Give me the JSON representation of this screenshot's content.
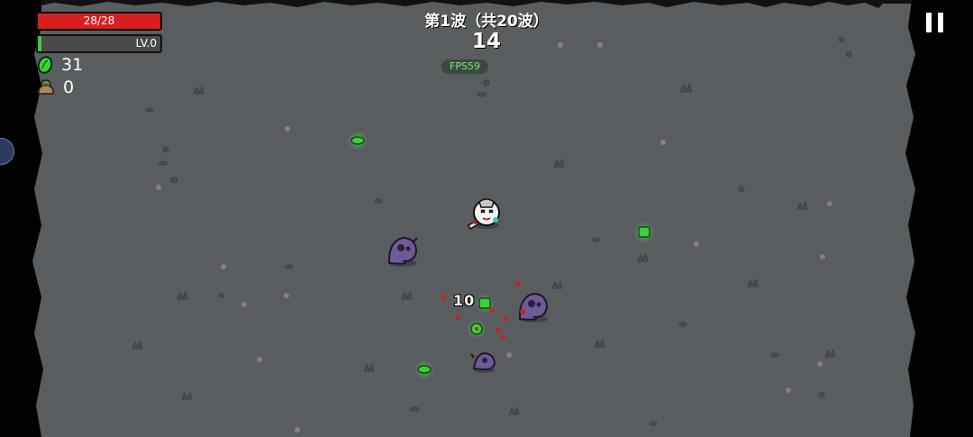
{
  "hud": {
    "hp_text": "28/28",
    "hp_fraction": 1.0,
    "level_text": "LV.0",
    "xp_fraction": 0.03,
    "materials_count": "31",
    "bag_count": "0",
    "wave_title": "第1波（共20波）",
    "timer": "14",
    "fps": "FPS59",
    "damage_number": "10"
  },
  "icons": {
    "materials": "green-material-icon",
    "bag": "loot-bag-icon",
    "pause": "pause-icon"
  },
  "colors": {
    "arena_floor": "#595d60",
    "hp_red": "#d81e1e",
    "xp_green": "#45c63b",
    "material_green": "#3bd13b",
    "enemy_purple": "#6e5a96",
    "blood_red": "#b52a2a"
  },
  "entities": {
    "enemy_count": 3,
    "material_drop_count": 5
  }
}
